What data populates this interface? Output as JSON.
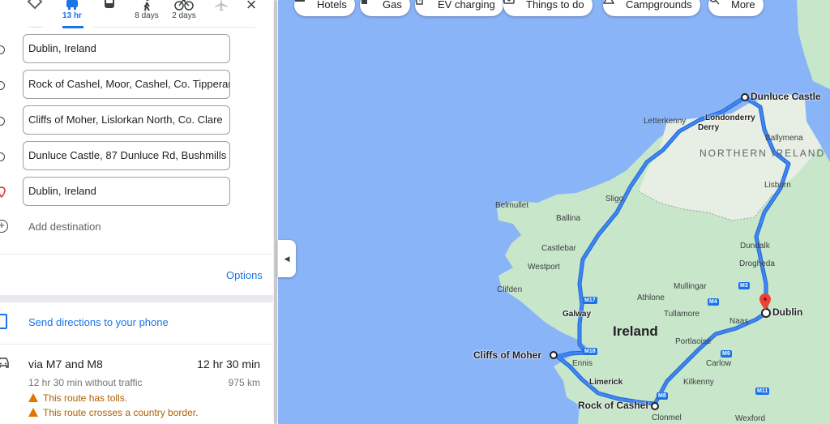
{
  "travel_modes": [
    {
      "name": "best",
      "label": ""
    },
    {
      "name": "car",
      "label": "13 hr"
    },
    {
      "name": "transit",
      "label": ""
    },
    {
      "name": "walk",
      "label": "8 days"
    },
    {
      "name": "bike",
      "label": "2 days"
    },
    {
      "name": "flight",
      "label": ""
    }
  ],
  "stops": [
    {
      "value": "Dublin, Ireland"
    },
    {
      "value": "Rock of Cashel, Moor, Cashel, Co. Tipperary"
    },
    {
      "value": "Cliffs of Moher, Lislorkan North, Co. Clare"
    },
    {
      "value": "Dunluce Castle, 87 Dunluce Rd, Bushmills"
    },
    {
      "value": "Dublin, Ireland"
    }
  ],
  "add_destination": "Add destination",
  "options_label": "Options",
  "send_directions": "Send directions to your phone",
  "route": {
    "title": "via M7 and M8",
    "time": "12 hr 30 min",
    "traffic_note": "12 hr 30 min without traffic",
    "distance": "975 km",
    "warnings": [
      "This route has tolls.",
      "This route crosses a country border."
    ]
  },
  "chips": [
    {
      "label": "Hotels",
      "icon": "bed-icon"
    },
    {
      "label": "Gas",
      "icon": "gas-pump-icon"
    },
    {
      "label": "EV charging",
      "icon": "ev-charging-icon"
    },
    {
      "label": "Things to do",
      "icon": "camera-icon"
    },
    {
      "label": "Campgrounds",
      "icon": "campground-icon"
    },
    {
      "label": "More",
      "icon": "search-icon"
    }
  ],
  "map": {
    "country_label": "Ireland",
    "region_label": "NORTHERN IRELAND",
    "stop_labels": {
      "dunluce": "Dunluce Castle",
      "dublin": "Dublin",
      "cliffs": "Cliffs of Moher",
      "cashel": "Rock of Cashel"
    },
    "towns": {
      "letterkenny": "Letterkenny",
      "londonderry": "Londonderry",
      "derry": "Derry",
      "ballymena": "Ballymena",
      "lisburn": "Lisburn",
      "belmullet": "Belmullet",
      "ballina": "Ballina",
      "sligo": "Sligo",
      "castlebar": "Castlebar",
      "westport": "Westport",
      "dundalk": "Dundalk",
      "drogheda": "Drogheda",
      "clifden": "Clifden",
      "mullingar": "Mullingar",
      "athlone": "Athlone",
      "tullamore": "Tullamore",
      "galway": "Galway",
      "naas": "Naas",
      "portlaoise": "Portlaoise",
      "carlow": "Carlow",
      "ennis": "Ennis",
      "limerick": "Limerick",
      "kilkenny": "Kilkenny",
      "clonmel": "Clonmel",
      "wexford": "Wexford"
    },
    "road_shields": [
      "M17",
      "M4",
      "M3",
      "M18",
      "M9",
      "M8",
      "M11"
    ],
    "route_color": "#1a73e8",
    "land_color": "#c8e6c9",
    "water_color": "#8ab4f8"
  }
}
